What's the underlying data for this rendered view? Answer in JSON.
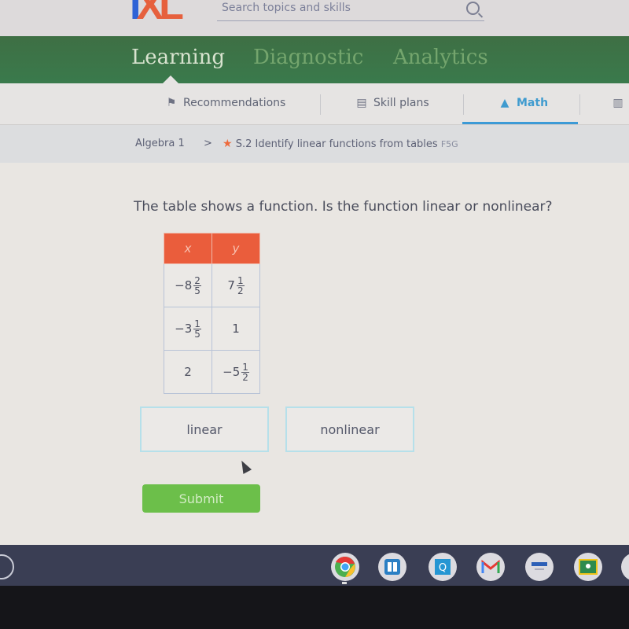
{
  "header": {
    "logo": {
      "i": "I",
      "xl": "XL"
    },
    "search_placeholder": "Search topics and skills"
  },
  "main_nav": {
    "tabs": [
      {
        "label": "Learning",
        "active": true
      },
      {
        "label": "Diagnostic",
        "active": false
      },
      {
        "label": "Analytics",
        "active": false
      }
    ]
  },
  "sub_nav": {
    "tabs": [
      {
        "label": "Recommendations",
        "icon": "signpost-icon",
        "active": false
      },
      {
        "label": "Skill plans",
        "icon": "skill-plan-icon",
        "active": false
      },
      {
        "label": "Math",
        "icon": "pyramid-icon",
        "active": true
      }
    ]
  },
  "breadcrumb": {
    "subject": "Algebra 1",
    "separator": ">",
    "skill": "S.2 Identify linear functions from tables",
    "code": "F5G"
  },
  "question": {
    "prompt": "The table shows a function. Is the function linear or nonlinear?",
    "table": {
      "headers": [
        "x",
        "y"
      ],
      "rows": [
        [
          {
            "sign": "−",
            "whole": "8",
            "num": "2",
            "den": "5"
          },
          {
            "sign": "",
            "whole": "7",
            "num": "1",
            "den": "2"
          }
        ],
        [
          {
            "sign": "−",
            "whole": "3",
            "num": "1",
            "den": "5"
          },
          {
            "sign": "",
            "whole": "1"
          }
        ],
        [
          {
            "sign": "",
            "whole": "2"
          },
          {
            "sign": "−",
            "whole": "5",
            "num": "1",
            "den": "2"
          }
        ]
      ]
    },
    "choices": [
      "linear",
      "nonlinear"
    ],
    "submit_label": "Submit"
  },
  "shelf": {
    "apps": [
      "chrome-icon",
      "reader-icon",
      "q-app-icon",
      "gmail-icon",
      "web-app-icon",
      "classroom-icon"
    ]
  }
}
